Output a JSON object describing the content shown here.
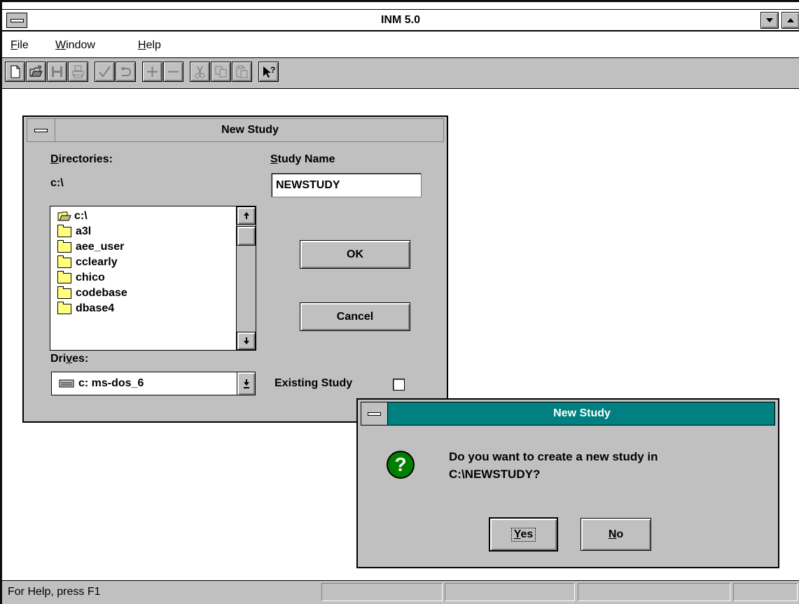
{
  "window": {
    "title": "INM 5.0"
  },
  "menu": {
    "items": [
      {
        "label": "File",
        "mnemonic": "F",
        "rest": "ile"
      },
      {
        "label": "Window",
        "mnemonic": "W",
        "rest": "indow"
      },
      {
        "label": "Help",
        "mnemonic": "H",
        "rest": "elp"
      }
    ]
  },
  "toolbar": {
    "buttons": [
      "new-icon",
      "open-icon",
      "save-icon",
      "print-icon",
      "check-icon",
      "undo-icon",
      "plus-icon",
      "minus-icon",
      "cut-icon",
      "copy-icon",
      "paste-icon",
      "context-help-icon"
    ]
  },
  "new_study_dialog": {
    "title": "New Study",
    "directories_label_mn": "D",
    "directories_label_rest": "irectories:",
    "current_dir": "c:\\",
    "dir_items": [
      "c:\\",
      "a3l",
      "aee_user",
      "cclearly",
      "chico",
      "codebase",
      "dbase4"
    ],
    "drives_label_pre": "Dri",
    "drives_label_mn": "v",
    "drives_label_rest": "es:",
    "drive_value": "c: ms-dos_6",
    "study_name_label_mn": "S",
    "study_name_label_rest": "tudy Name",
    "study_name_value": "NEWSTUDY",
    "ok_label": "OK",
    "cancel_label": "Cancel",
    "existing_study_label": "Existing Study",
    "existing_study_checked": false
  },
  "confirm_dialog": {
    "title": "New Study",
    "message_line1": "Do you want to create a new study in",
    "message_line2": "C:\\NEWSTUDY?",
    "icon": "question-icon",
    "yes_mn": "Y",
    "yes_rest": "es",
    "no_mn": "N",
    "no_rest": "o"
  },
  "status_bar": {
    "text": "For Help, press F1"
  },
  "colors": {
    "title_active": "#008080",
    "face": "#c0c0c0",
    "workspace": "#ffffff",
    "question": "#008000"
  }
}
